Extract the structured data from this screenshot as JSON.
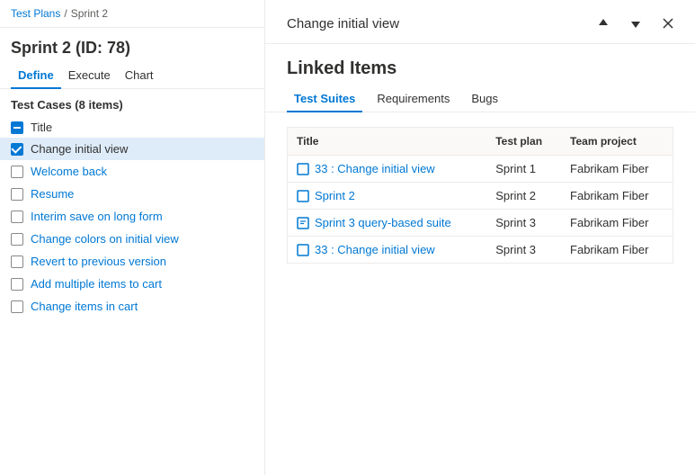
{
  "breadcrumb": {
    "parent": "Test Plans",
    "separator": "/",
    "current": "Sprint 2"
  },
  "sprint": {
    "title": "Sprint 2 (ID: 78)"
  },
  "tabs": [
    {
      "label": "Define",
      "active": true
    },
    {
      "label": "Execute",
      "active": false
    },
    {
      "label": "Chart",
      "active": false
    }
  ],
  "testCasesHeader": "Test Cases (8 items)",
  "listTitleLabel": "Title",
  "listItems": [
    {
      "id": 1,
      "text": "Change initial view",
      "checked": true,
      "selected": true,
      "checkType": "checked"
    },
    {
      "id": 2,
      "text": "Welcome back",
      "checked": false,
      "selected": false,
      "checkType": "unchecked"
    },
    {
      "id": 3,
      "text": "Resume",
      "checked": false,
      "selected": false,
      "checkType": "unchecked"
    },
    {
      "id": 4,
      "text": "Interim save on long form",
      "checked": false,
      "selected": false,
      "checkType": "unchecked"
    },
    {
      "id": 5,
      "text": "Change colors on initial view",
      "checked": false,
      "selected": false,
      "checkType": "unchecked"
    },
    {
      "id": 6,
      "text": "Revert to previous version",
      "checked": false,
      "selected": false,
      "checkType": "unchecked"
    },
    {
      "id": 7,
      "text": "Add multiple items to cart",
      "checked": false,
      "selected": false,
      "checkType": "unchecked"
    },
    {
      "id": 8,
      "text": "Change items in cart",
      "checked": false,
      "selected": false,
      "checkType": "unchecked"
    }
  ],
  "panelTitle": "Change initial view",
  "linkedItemsTitle": "Linked Items",
  "panelTabs": [
    {
      "label": "Test Suites",
      "active": true
    },
    {
      "label": "Requirements",
      "active": false
    },
    {
      "label": "Bugs",
      "active": false
    }
  ],
  "tableColumns": [
    "Title",
    "Test plan",
    "Team project"
  ],
  "tableRows": [
    {
      "icon": "suite",
      "title": "33 : Change initial view",
      "testPlan": "Sprint 1",
      "teamProject": "Fabrikam Fiber"
    },
    {
      "icon": "suite",
      "title": "Sprint 2",
      "testPlan": "Sprint 2",
      "teamProject": "Fabrikam Fiber"
    },
    {
      "icon": "query",
      "title": "Sprint 3 query-based suite",
      "testPlan": "Sprint 3",
      "teamProject": "Fabrikam Fiber"
    },
    {
      "icon": "suite",
      "title": "33 : Change initial view",
      "testPlan": "Sprint 3",
      "teamProject": "Fabrikam Fiber"
    }
  ],
  "icons": {
    "up": "↑",
    "down": "↓",
    "close": "✕"
  }
}
